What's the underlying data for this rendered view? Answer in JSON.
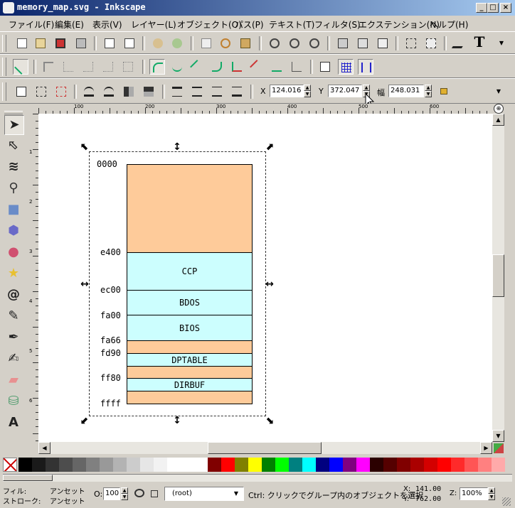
{
  "window": {
    "title": "memory_map.svg - Inkscape",
    "buttons": [
      "_",
      "□",
      "×"
    ]
  },
  "menu": [
    "ファイル(F)",
    "編集(E)",
    "表示(V)",
    "レイヤー(L)",
    "オブジェクト(O)",
    "パス(P)",
    "テキスト(T)",
    "フィルタ(S)",
    "エクステンション(N)",
    "ヘルプ(H)"
  ],
  "toolbar_main": {
    "icons": [
      "new-document-icon",
      "open-icon",
      "save-icon",
      "print-icon",
      "import-icon",
      "export-icon",
      "undo-icon",
      "redo-icon",
      "duplicate-icon",
      "cut-icon",
      "paste-icon",
      "zoom-selection-icon",
      "zoom-drawing-icon",
      "zoom-page-icon",
      "group-icon",
      "ungroup-icon",
      "clone-icon",
      "align-icon",
      "node-editor-icon",
      "text-tool-icon"
    ]
  },
  "toolbar_snap": {
    "icons": [
      "snap-enable-icon",
      "snap-bbox-icon",
      "snap-bbox-edge-icon",
      "snap-bbox-corner-icon",
      "snap-bbox-midpoint-icon",
      "snap-bbox-center-icon",
      "snap-nodes-icon",
      "snap-path-icon",
      "snap-intersection-icon",
      "snap-smooth-icon",
      "snap-midpoint-icon",
      "snap-center-icon",
      "snap-rotation-icon",
      "snap-page-icon",
      "snap-grid-icon",
      "snap-guide-icon"
    ]
  },
  "toolbar_select": {
    "icons": [
      "select-all-icon",
      "select-all-layers-icon",
      "deselect-icon",
      "rotate-ccw-icon",
      "rotate-cw-icon",
      "flip-horizontal-icon",
      "flip-vertical-icon",
      "raise-top-icon",
      "raise-icon",
      "lower-icon",
      "lower-bottom-icon"
    ],
    "x_label": "X",
    "x_value": "124.016",
    "y_label": "Y",
    "y_value": "372.047",
    "w_label": "幅",
    "w_value": "248.031",
    "lock_icon": "lock-icon"
  },
  "ruler": {
    "h_ticks": [
      "100",
      "200",
      "300",
      "400",
      "500",
      "600"
    ],
    "v_ticks": [
      "1",
      "2",
      "3",
      "4",
      "5",
      "6"
    ]
  },
  "tools": [
    "selector-tool-icon",
    "node-tool-icon",
    "tweak-tool-icon",
    "zoom-tool-icon",
    "rect-tool-icon",
    "3dbox-tool-icon",
    "ellipse-tool-icon",
    "star-tool-icon",
    "spiral-tool-icon",
    "pencil-tool-icon",
    "pen-tool-icon",
    "calligraphy-tool-icon",
    "eraser-tool-icon",
    "paint-bucket-tool-icon",
    "text-tool-icon"
  ],
  "memory_map": {
    "labels": [
      "0000",
      "e400",
      "ec00",
      "fa00",
      "fa66",
      "fd90",
      "ff80",
      "ffff"
    ],
    "blocks": [
      "",
      "CCP",
      "BDOS",
      "BIOS",
      "",
      "DPTABLE",
      "",
      "DIRBUF"
    ]
  },
  "colors": {
    "orange_block": "#fecb9a",
    "cyan_block": "#ccfefe"
  },
  "palette": [
    "#000000",
    "#1a1a1a",
    "#333333",
    "#4d4d4d",
    "#666666",
    "#808080",
    "#999999",
    "#b3b3b3",
    "#cccccc",
    "#e6e6e6",
    "#f2f2f2",
    "#ffffff",
    "#ffffff",
    "#ffffff",
    "#800000",
    "#ff0000",
    "#808000",
    "#ffff00",
    "#008000",
    "#00ff00",
    "#008080",
    "#00ffff",
    "#000080",
    "#0000ff",
    "#800080",
    "#ff00ff",
    "#2b0000",
    "#550000",
    "#800000",
    "#aa0000",
    "#d40000",
    "#ff0000",
    "#ff2a2a",
    "#ff5555",
    "#ff8080",
    "#ffaaaa"
  ],
  "status": {
    "fill_label": "フィル:",
    "fill_value": "アンセット",
    "stroke_label": "ストローク:",
    "stroke_value": "アンセット",
    "opacity_label": "O:",
    "opacity_value": "100",
    "layer_value": "(root)",
    "message": "Ctrl: クリックでグループ内のオブジェクトを選択",
    "x_label": "X:",
    "x_value": "141.00",
    "y_label": "Y:",
    "y_value": "762.00",
    "zoom_label": "Z:",
    "zoom_value": "100%"
  }
}
